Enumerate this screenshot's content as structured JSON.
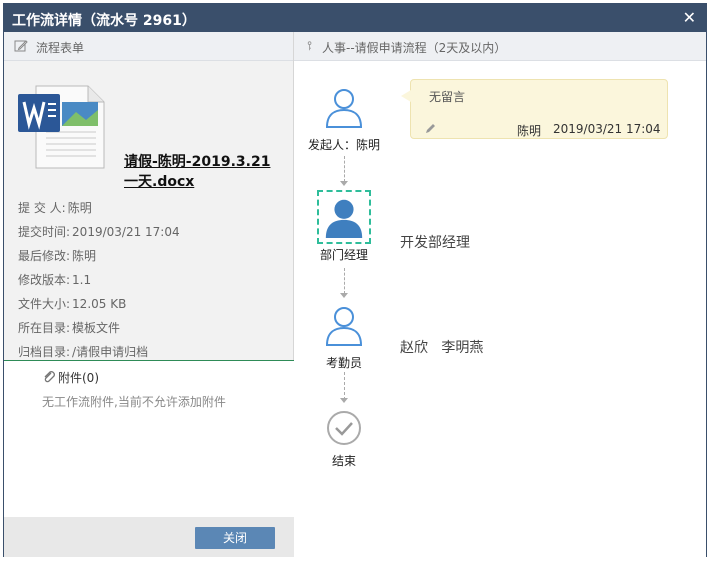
{
  "window": {
    "title": "工作流详情（流水号 2961）",
    "close_symbol": "✕"
  },
  "left_panel": {
    "header": "流程表单",
    "file": {
      "name_line1": "请假-陈明-2019.3.21",
      "name_line2": "一天.docx"
    },
    "info": [
      {
        "key": "提 交 人:",
        "value": "陈明"
      },
      {
        "key": "提交时间:",
        "value": "2019/03/21 17:04"
      },
      {
        "key": "最后修改:",
        "value": "陈明"
      },
      {
        "key": "修改版本:",
        "value": "1.1"
      },
      {
        "key": "文件大小:",
        "value": "12.05 KB"
      },
      {
        "key": "所在目录:",
        "value": "模板文件"
      },
      {
        "key": "归档目录:",
        "value": "/请假申请归档"
      }
    ],
    "attachments_label": "附件(0)",
    "attachments_note": "无工作流附件,当前不允许添加附件",
    "close_button": "关闭"
  },
  "right_panel": {
    "header": "人事--请假申请流程（2天及以内）",
    "nodes": [
      {
        "label": "发起人：陈明",
        "state": "done"
      },
      {
        "label": "部门经理",
        "state": "current",
        "assignees": "开发部经理"
      },
      {
        "label": "考勤员",
        "state": "pending",
        "assignees": "赵欣   李明燕"
      },
      {
        "label": "结束",
        "state": "end"
      }
    ],
    "comment": {
      "text": "无留言",
      "author": "陈明",
      "time": "2019/03/21 17:04"
    }
  },
  "colors": {
    "titlebar": "#3a4f6b",
    "accent_blue": "#4a90d9",
    "current_blue": "#3f7fbf",
    "selection_green": "#2ebd9a",
    "button_blue": "#5b87b5"
  }
}
